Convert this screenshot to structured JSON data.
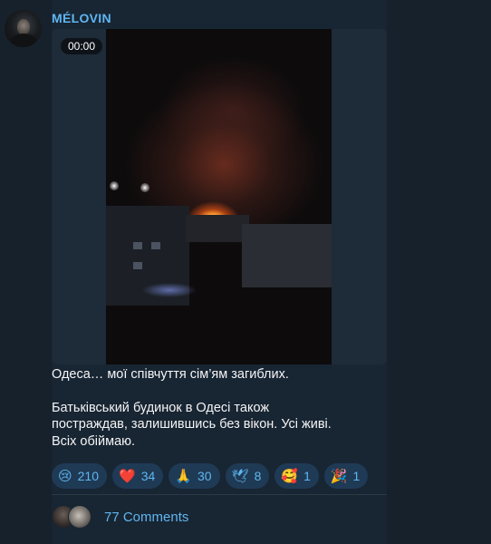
{
  "post": {
    "channel_name": "MÉLOVIN",
    "video_time": "00:00",
    "text_line1": "Одеса… мої співчуття сім’ям загиблих.",
    "text_line2": "Батьківський будинок в Одесі також",
    "text_line3": "постраждав, залишившись без вікон. Усі живі.",
    "text_line4": "Всіх обіймаю."
  },
  "reactions": [
    {
      "emoji": "😢",
      "count": "210"
    },
    {
      "emoji": "❤️",
      "count": "34"
    },
    {
      "emoji": "🙏",
      "count": "30"
    },
    {
      "emoji": "🕊",
      "count": "8"
    },
    {
      "emoji": "🥰",
      "count": "1"
    },
    {
      "emoji": "🎉",
      "count": "1"
    }
  ],
  "comments": {
    "label": "77 Comments"
  }
}
